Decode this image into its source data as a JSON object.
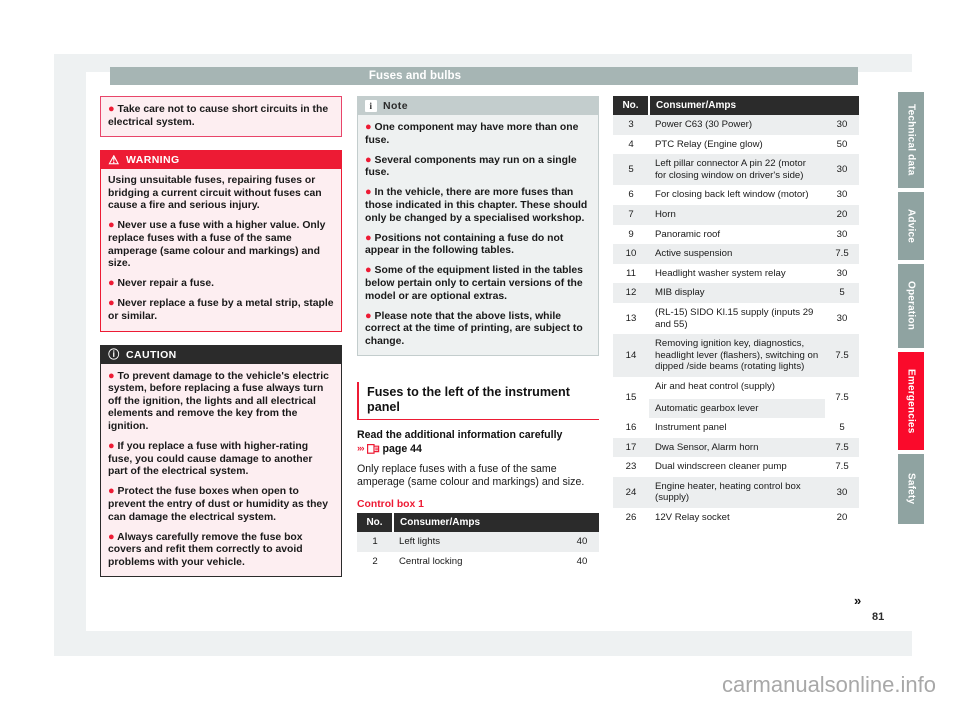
{
  "header": {
    "title": "Fuses and bulbs"
  },
  "footer": {
    "page_number": "81",
    "watermark": "carmanualsonline.info",
    "continue_marker": "»"
  },
  "tabs": [
    {
      "label": "Technical data",
      "active": false
    },
    {
      "label": "Advice",
      "active": false
    },
    {
      "label": "Operation",
      "active": false
    },
    {
      "label": "Emergencies",
      "active": true
    },
    {
      "label": "Safety",
      "active": false
    }
  ],
  "column1": {
    "pink_note": {
      "bullet": "●",
      "text": "Take care not to cause short circuits in the electrical system."
    },
    "warning": {
      "icon": "warning-triangle-icon",
      "icon_glyph": "⚠",
      "title": "WARNING",
      "paragraphs": [
        {
          "bullet": "",
          "text": "Using unsuitable fuses, repairing fuses or bridging a current circuit without fuses can cause a fire and serious injury."
        },
        {
          "bullet": "●",
          "text": "Never use a fuse with a higher value. Only replace fuses with a fuse of the same amperage (same colour and markings) and size."
        },
        {
          "bullet": "●",
          "text": "Never repair a fuse."
        },
        {
          "bullet": "●",
          "text": "Never replace a fuse by a metal strip, staple or similar."
        }
      ]
    },
    "caution": {
      "icon": "exclamation-circle-icon",
      "icon_glyph": "ⓘ",
      "title": "CAUTION",
      "paragraphs": [
        {
          "bullet": "●",
          "text": "To prevent damage to the vehicle's electric system, before replacing a fuse always turn off the ignition, the lights and all electrical elements and remove the key from the ignition."
        },
        {
          "bullet": "●",
          "text": "If you replace a fuse with higher-rating fuse, you could cause damage to another part of the electrical system."
        },
        {
          "bullet": "●",
          "text": "Protect the fuse boxes when open to prevent the entry of dust or humidity as they can damage the electrical system."
        },
        {
          "bullet": "●",
          "text": "Always carefully remove the fuse box covers and refit them correctly to avoid problems with your vehicle."
        }
      ]
    }
  },
  "column2": {
    "note": {
      "icon": "info-icon",
      "icon_glyph": "i",
      "title": "Note",
      "paragraphs": [
        {
          "bullet": "●",
          "text": "One component may have more than one fuse."
        },
        {
          "bullet": "●",
          "text": "Several components may run on a single fuse."
        },
        {
          "bullet": "●",
          "text": "In the vehicle, there are more fuses than those indicated in this chapter. These should only be changed by a specialised workshop."
        },
        {
          "bullet": "●",
          "text": "Positions not containing a fuse do not appear in the following tables."
        },
        {
          "bullet": "●",
          "text": "Some of the equipment listed in the tables below pertain only to certain versions of the model or are optional extras."
        },
        {
          "bullet": "●",
          "text": "Please note that the above lists, while correct at the time of printing, are subject to change."
        }
      ]
    },
    "section": {
      "heading": "Fuses to the left of the instrument panel",
      "subheading": "Read the additional information carefully",
      "ref_chevrons": "›››",
      "ref_icon": "book-reference-icon",
      "ref_text": "page 44",
      "body": "Only replace fuses with a fuse of the same amperage (same colour and markings) and size.",
      "table_label": "Control box 1"
    },
    "table": {
      "columns": [
        "No.",
        "Consumer/Amps"
      ],
      "rows": [
        {
          "no": "1",
          "consumer": "Left lights",
          "amps": "40"
        },
        {
          "no": "2",
          "consumer": "Central locking",
          "amps": "40"
        }
      ]
    }
  },
  "column3": {
    "table": {
      "columns": [
        "No.",
        "Consumer/Amps"
      ],
      "rows": [
        {
          "no": "3",
          "consumer": "Power C63 (30 Power)",
          "amps": "30"
        },
        {
          "no": "4",
          "consumer": "PTC Relay (Engine glow)",
          "amps": "50"
        },
        {
          "no": "5",
          "consumer": "Left pillar connector A pin 22 (motor for closing window on driver's side)",
          "amps": "30"
        },
        {
          "no": "6",
          "consumer": "For closing back left window (motor)",
          "amps": "30"
        },
        {
          "no": "7",
          "consumer": "Horn",
          "amps": "20"
        },
        {
          "no": "9",
          "consumer": "Panoramic roof",
          "amps": "30"
        },
        {
          "no": "10",
          "consumer": "Active suspension",
          "amps": "7.5"
        },
        {
          "no": "11",
          "consumer": "Headlight washer system relay",
          "amps": "30"
        },
        {
          "no": "12",
          "consumer": "MIB display",
          "amps": "5"
        },
        {
          "no": "13",
          "consumer": "(RL-15) SIDO Kl.15 supply (inputs 29 and 55)",
          "amps": "30"
        },
        {
          "no": "14",
          "consumer": "Removing ignition key, diagnostics, headlight lever (flashers), switching on dipped /side beams (rotating lights)",
          "amps": "7.5"
        },
        {
          "no": "15",
          "consumer": "Air and heat control (supply)",
          "consumer2": "Automatic gearbox lever",
          "amps": "7.5"
        },
        {
          "no": "16",
          "consumer": "Instrument panel",
          "amps": "5"
        },
        {
          "no": "17",
          "consumer": "Dwa Sensor, Alarm horn",
          "amps": "7.5"
        },
        {
          "no": "23",
          "consumer": "Dual windscreen cleaner pump",
          "amps": "7.5"
        },
        {
          "no": "24",
          "consumer": "Engine heater, heating control box (supply)",
          "amps": "30"
        },
        {
          "no": "26",
          "consumer": "12V Relay socket",
          "amps": "20"
        }
      ]
    }
  },
  "colors": {
    "accent_red": "#ed1b34",
    "header_gray": "#a6b5b4",
    "tab_gray": "#8fa3a1",
    "tab_active_red": "#fa0a2b",
    "table_header_dark": "#2b2b2b",
    "row_stripe": "#eceeef"
  }
}
